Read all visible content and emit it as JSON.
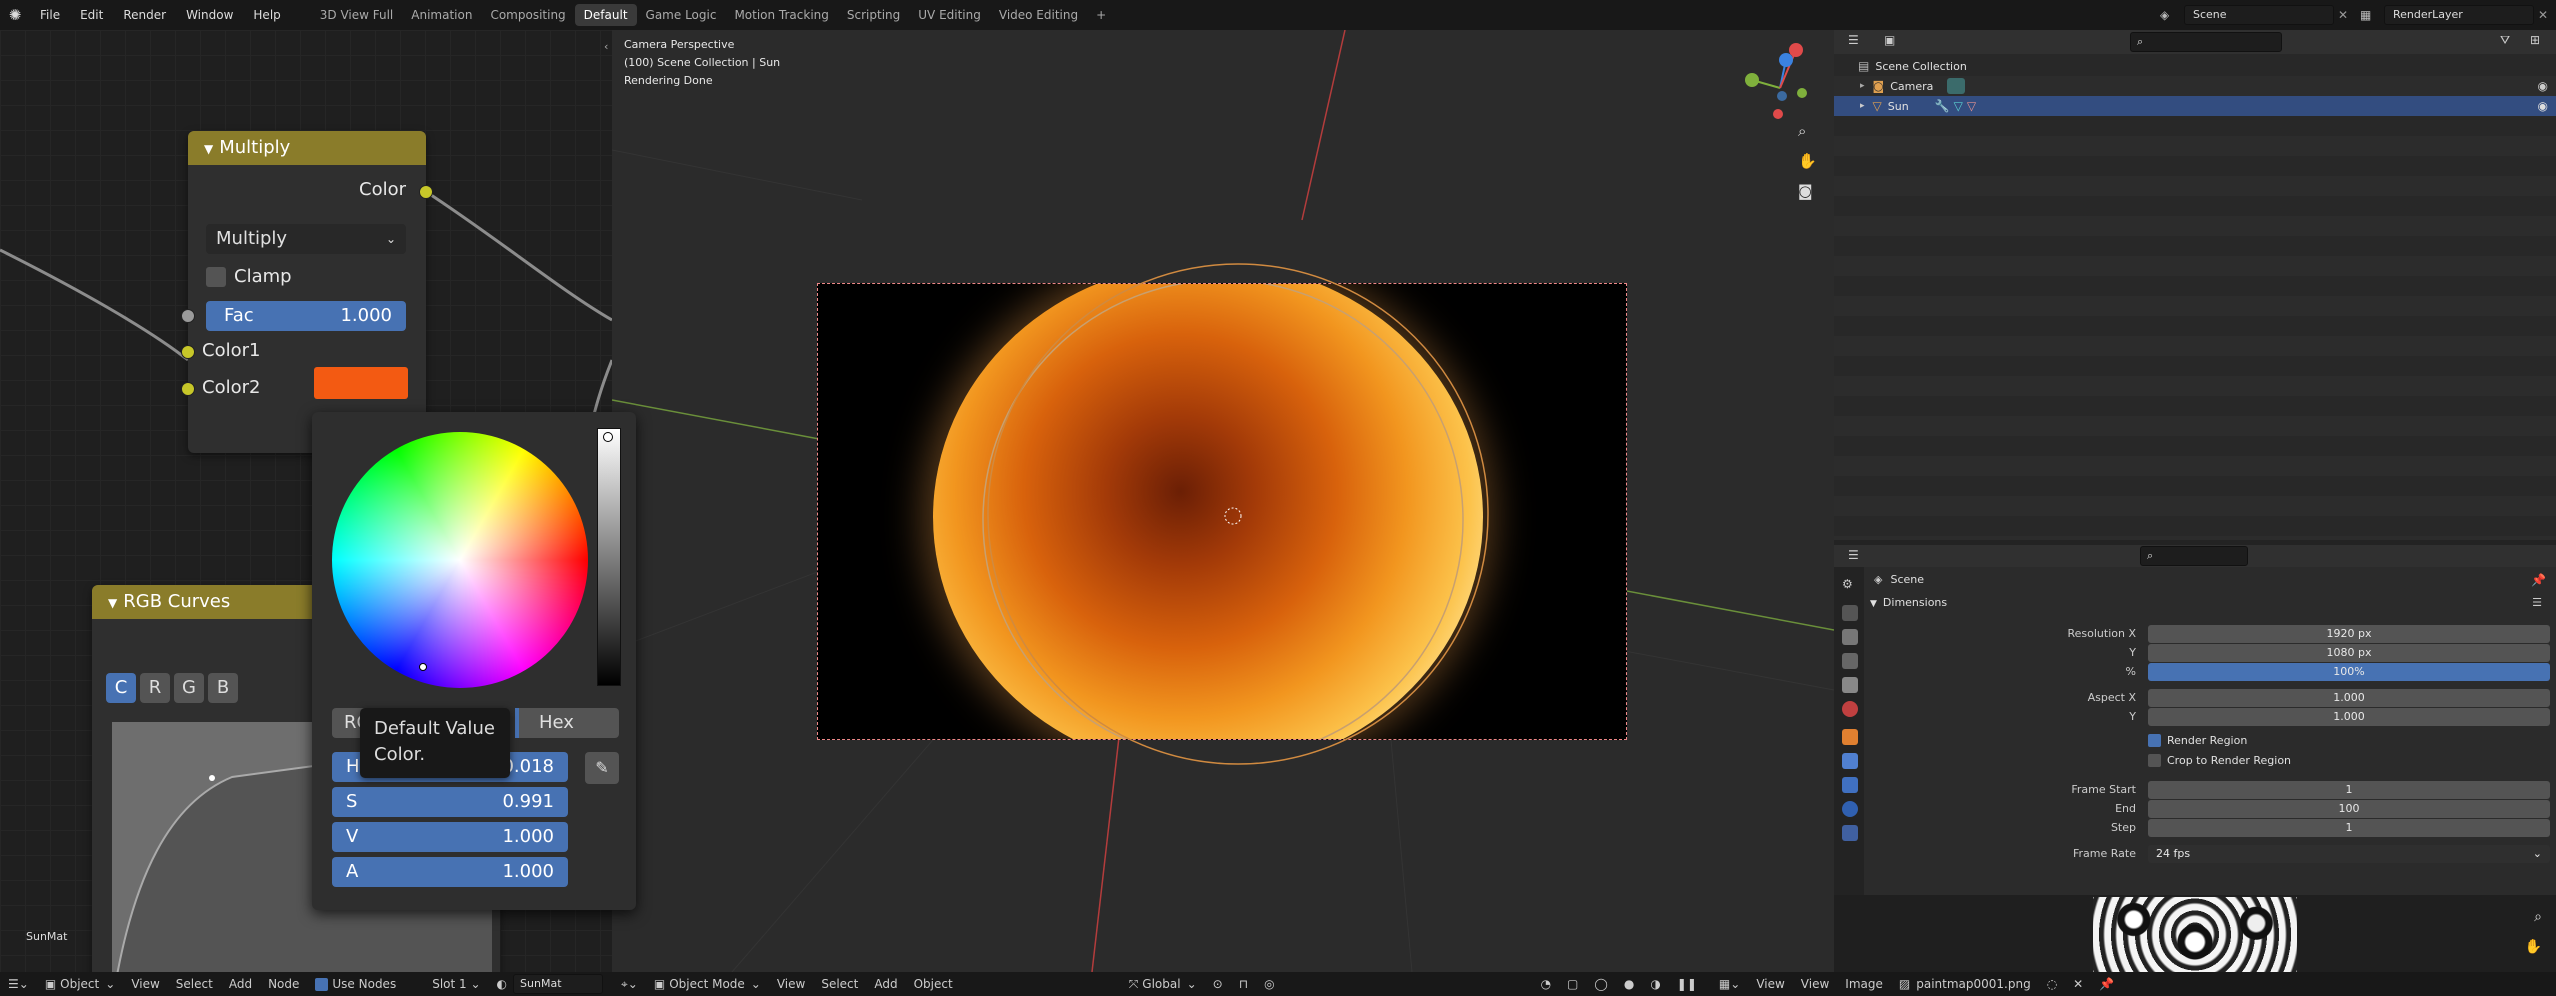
{
  "topbar": {
    "menus": [
      "File",
      "Edit",
      "Render",
      "Window",
      "Help"
    ],
    "workspaces": [
      "3D View Full",
      "Animation",
      "Compositing",
      "Default",
      "Game Logic",
      "Motion Tracking",
      "Scripting",
      "UV Editing",
      "Video Editing"
    ],
    "active_workspace": "Default",
    "add_tab": "+",
    "scene": "Scene",
    "render_layer": "RenderLayer"
  },
  "node_editor": {
    "multiply_node": {
      "title": "Multiply",
      "output": "Color",
      "blend_mode": "Multiply",
      "clamp_label": "Clamp",
      "fac_label": "Fac",
      "fac_value": "1.000",
      "color1": "Color1",
      "color2": "Color2",
      "color2_swatch": "#f35a12"
    },
    "curves_node": {
      "title": "RGB Curves",
      "channels": [
        "C",
        "R",
        "G",
        "B"
      ]
    },
    "material_label": "SunMat"
  },
  "color_popup": {
    "mode_rgb": "RGB",
    "mode_hex": "Hex",
    "tooltip_line1": "Default Value",
    "tooltip_line2": "Color.",
    "h_label": "H",
    "h_value": "0.018",
    "s_label": "S",
    "s_value": "0.991",
    "v_label": "V",
    "v_value": "1.000",
    "a_label": "A",
    "a_value": "1.000"
  },
  "viewport": {
    "line1": "Camera Perspective",
    "line2": "(100) Scene Collection | Sun",
    "line3": "Rendering Done"
  },
  "outliner": {
    "root": "Scene Collection",
    "items": [
      {
        "label": "Camera",
        "selected": false
      },
      {
        "label": "Sun",
        "selected": true
      }
    ]
  },
  "properties": {
    "context": "Scene",
    "panel": "Dimensions",
    "rows": [
      {
        "label": "Resolution X",
        "value": "1920 px"
      },
      {
        "label": "Y",
        "value": "1080 px"
      },
      {
        "label": "%",
        "value": "100%"
      },
      {
        "label": "Aspect X",
        "value": "1.000"
      },
      {
        "label": "Y",
        "value": "1.000"
      }
    ],
    "render_region": "Render Region",
    "crop_region": "Crop to Render Region",
    "frame_rows": [
      {
        "label": "Frame Start",
        "value": "1"
      },
      {
        "label": "End",
        "value": "100"
      },
      {
        "label": "Step",
        "value": "1"
      }
    ],
    "frame_rate_label": "Frame Rate",
    "frame_rate_value": "24 fps"
  },
  "bottombar": {
    "node_mode": "Object",
    "node_menus": [
      "View",
      "Select",
      "Add",
      "Node"
    ],
    "use_nodes": "Use Nodes",
    "slot": "Slot 1",
    "material": "SunMat",
    "vp_mode": "Object Mode",
    "vp_menus": [
      "View",
      "Select",
      "Add",
      "Object"
    ],
    "transform": "Global",
    "img_menus": [
      "View",
      "View",
      "Image"
    ],
    "image_name": "paintmap0001.png"
  }
}
